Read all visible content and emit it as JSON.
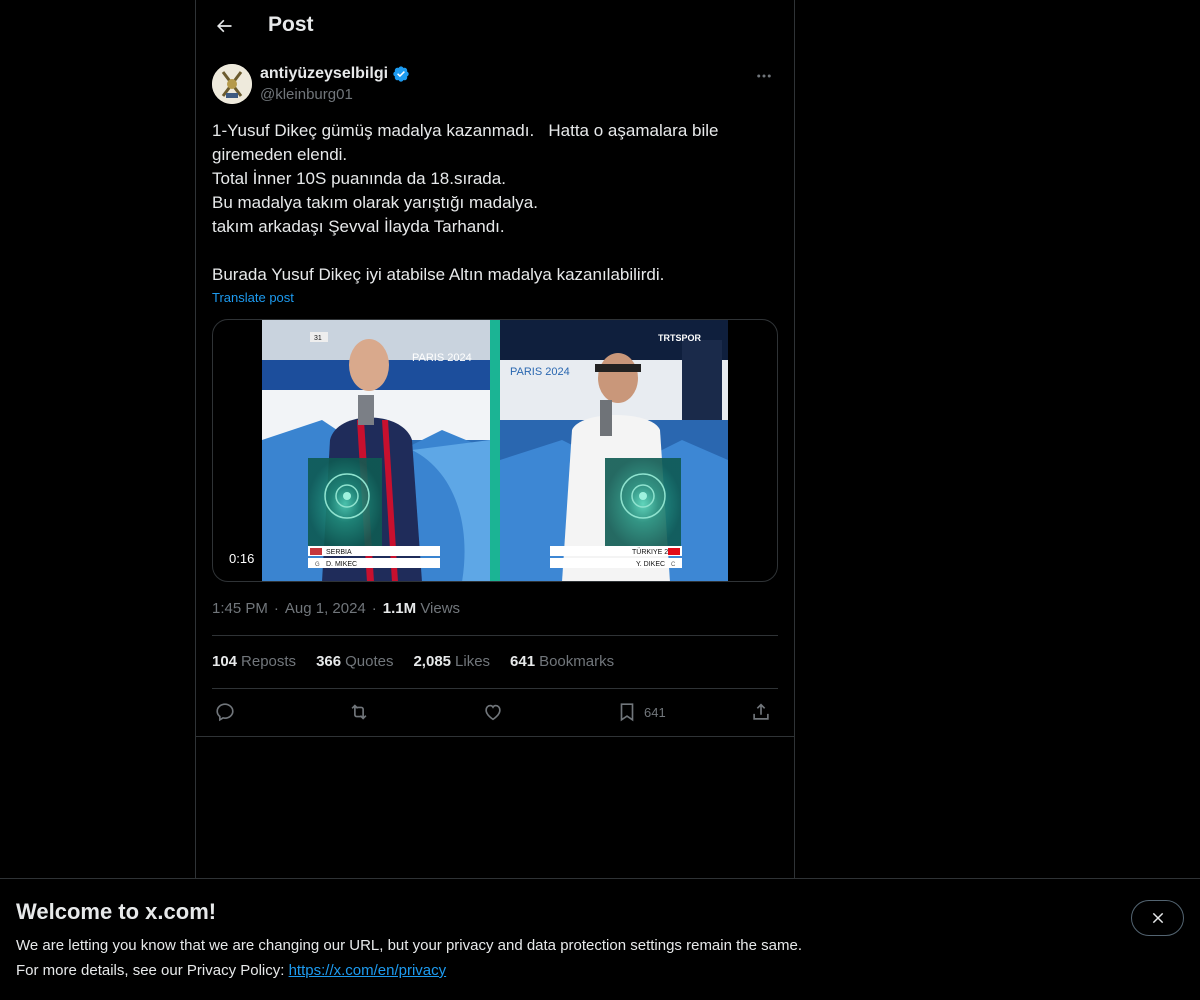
{
  "header": {
    "title": "Post"
  },
  "author": {
    "display_name": "antiyüzeyselbilgi",
    "handle": "@kleinburg01"
  },
  "tweet": {
    "text": "1-Yusuf Dikeç gümüş madalya kazanmadı.   Hatta o aşamalara bile giremeden elendi.\nTotal İnner 10S puanında da 18.sırada.\nBu madalya takım olarak yarıştığı madalya.\ntakım arkadaşı Şevval İlayda Tarhandı.\n\nBurada Yusuf Dikeç iyi atabilse Altın madalya kazanılabilirdi.",
    "translate_label": "Translate post"
  },
  "media": {
    "duration": "0:16",
    "left_badge": "31",
    "left_banner": "PARIS 2024",
    "right_banner": "PARIS 2024",
    "broadcaster": "TRTSPOR",
    "left_country": "SERBIA",
    "left_athlete": "D. MIKEC",
    "left_letter": "G",
    "right_country": "TÜRKIYE 2",
    "right_athlete": "Y. DIKEC",
    "right_letter": "C"
  },
  "meta": {
    "time": "1:45 PM",
    "date": "Aug 1, 2024",
    "views_count": "1.1M",
    "views_label": "Views",
    "sep": "·"
  },
  "stats": {
    "reposts_count": "104",
    "reposts_label": "Reposts",
    "quotes_count": "366",
    "quotes_label": "Quotes",
    "likes_count": "2,085",
    "likes_label": "Likes",
    "bookmarks_count": "641",
    "bookmarks_label": "Bookmarks"
  },
  "actions": {
    "bookmark_count": "641"
  },
  "banner": {
    "title": "Welcome to x.com!",
    "line1": "We are letting you know that we are changing our URL, but your privacy and data protection settings remain the same.",
    "line2_prefix": "For more details, see our Privacy Policy: ",
    "link": "https://x.com/en/privacy"
  },
  "colors": {
    "accent": "#1d9bf0",
    "muted": "#71767b",
    "text": "#e7e9ea",
    "border": "#2f3336"
  },
  "icons": [
    "back-arrow-icon",
    "verified-badge-icon",
    "more-icon",
    "reply-icon",
    "repost-icon",
    "like-icon",
    "bookmark-icon",
    "share-icon",
    "close-icon"
  ]
}
